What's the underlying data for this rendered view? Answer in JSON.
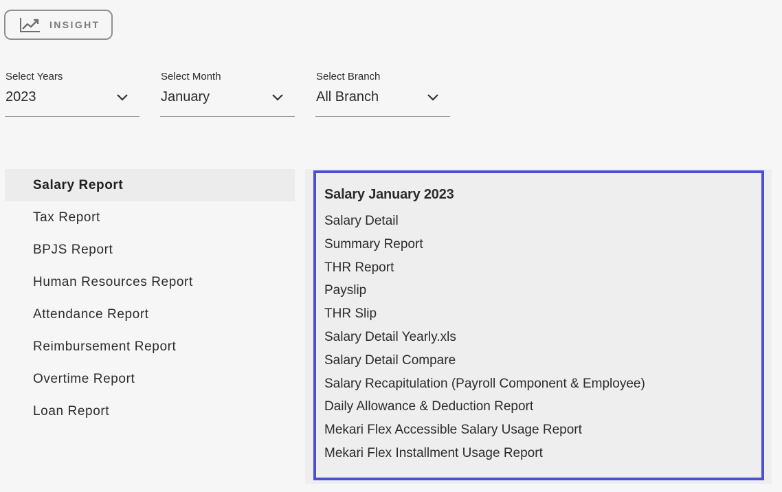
{
  "insight_button": {
    "label": "INSIGHT",
    "icon": "trend-chart-icon"
  },
  "filters": {
    "years": {
      "label": "Select Years",
      "value": "2023"
    },
    "month": {
      "label": "Select Month",
      "value": "January"
    },
    "branch": {
      "label": "Select Branch",
      "value": "All Branch"
    }
  },
  "menu": {
    "items": [
      {
        "label": "Salary Report",
        "active": true
      },
      {
        "label": "Tax Report"
      },
      {
        "label": "BPJS Report"
      },
      {
        "label": "Human Resources Report"
      },
      {
        "label": "Attendance Report"
      },
      {
        "label": "Reimbursement Report"
      },
      {
        "label": "Overtime Report"
      },
      {
        "label": "Loan Report"
      }
    ]
  },
  "panel": {
    "title": "Salary January 2023",
    "reports": [
      "Salary Detail",
      "Summary Report",
      "THR Report",
      "Payslip",
      "THR Slip",
      "Salary Detail Yearly.xls",
      "Salary Detail Compare",
      "Salary Recapitulation (Payroll Component & Employee)",
      "Daily Allowance & Deduction Report",
      "Mekari Flex Accessible Salary Usage Report",
      "Mekari Flex Installment Usage Report"
    ]
  },
  "colors": {
    "highlight_border": "#4a4fd4",
    "active_menu_bg": "#ececec"
  }
}
